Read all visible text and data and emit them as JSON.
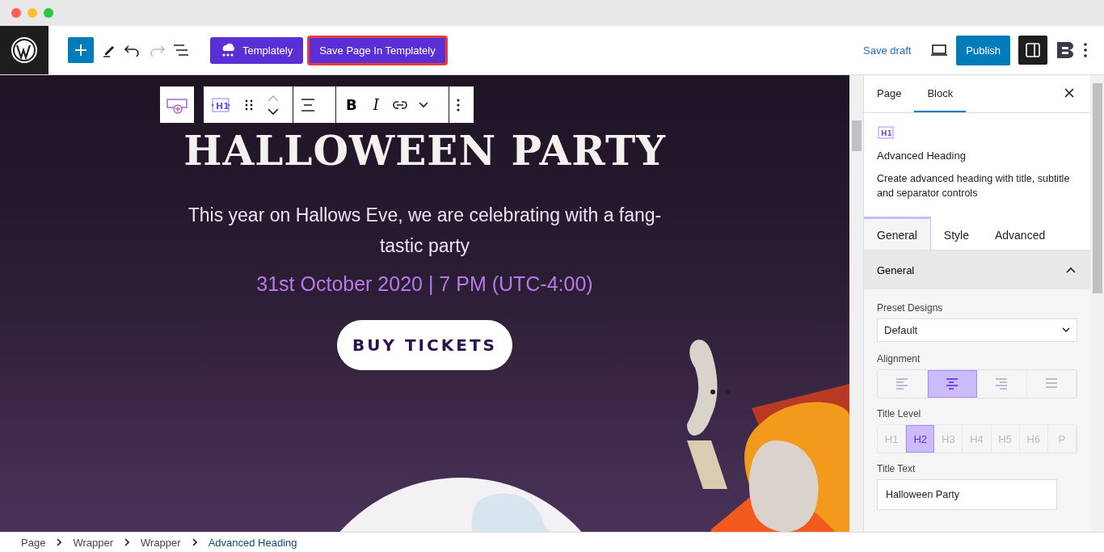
{
  "toolbar": {
    "templately_button": "Templately",
    "save_button": "Save Page In Templately",
    "save_draft": "Save draft",
    "publish": "Publish"
  },
  "block_toolbar": {
    "type_icon_label": "H1",
    "bold": "B",
    "italic": "I"
  },
  "canvas": {
    "heading": "HALLOWEEN PARTY",
    "subtitle": "This year on Hallows Eve, we are celebrating with a fang-tastic party",
    "date": "31st October 2020 | 7 PM (UTC-4:00)",
    "button": "BUY TICKETS"
  },
  "sidebar": {
    "block_icon_label": "H1",
    "tabs": [
      {
        "label": "Page",
        "selected": false
      },
      {
        "label": "Block",
        "selected": true
      }
    ],
    "block_title": "Advanced Heading",
    "block_description": "Create advanced heading with title, subtitle and separator controls",
    "inner_tabs": [
      {
        "label": "General",
        "selected": true
      },
      {
        "label": "Style",
        "selected": false
      },
      {
        "label": "Advanced",
        "selected": false
      }
    ],
    "panel": {
      "title": "General",
      "expanded": true,
      "preset_label": "Preset Designs",
      "preset_value": "Default",
      "alignment_label": "Alignment",
      "alignment": [
        {
          "kind": "left",
          "selected": false
        },
        {
          "kind": "center",
          "selected": true
        },
        {
          "kind": "right",
          "selected": false
        },
        {
          "kind": "justify",
          "selected": false
        }
      ],
      "title_level_label": "Title Level",
      "title_levels": [
        {
          "label": "H1",
          "selected": false
        },
        {
          "label": "H2",
          "selected": true
        },
        {
          "label": "H3",
          "selected": false
        },
        {
          "label": "H4",
          "selected": false
        },
        {
          "label": "H5",
          "selected": false
        },
        {
          "label": "H6",
          "selected": false
        },
        {
          "label": "P",
          "selected": false
        }
      ],
      "title_text_label": "Title Text",
      "title_text_value": "Halloween Party"
    }
  },
  "breadcrumb": [
    {
      "label": "Page",
      "current": false
    },
    {
      "label": "Wrapper",
      "current": false
    },
    {
      "label": "Wrapper",
      "current": false
    },
    {
      "label": "Advanced Heading",
      "current": true
    }
  ]
}
